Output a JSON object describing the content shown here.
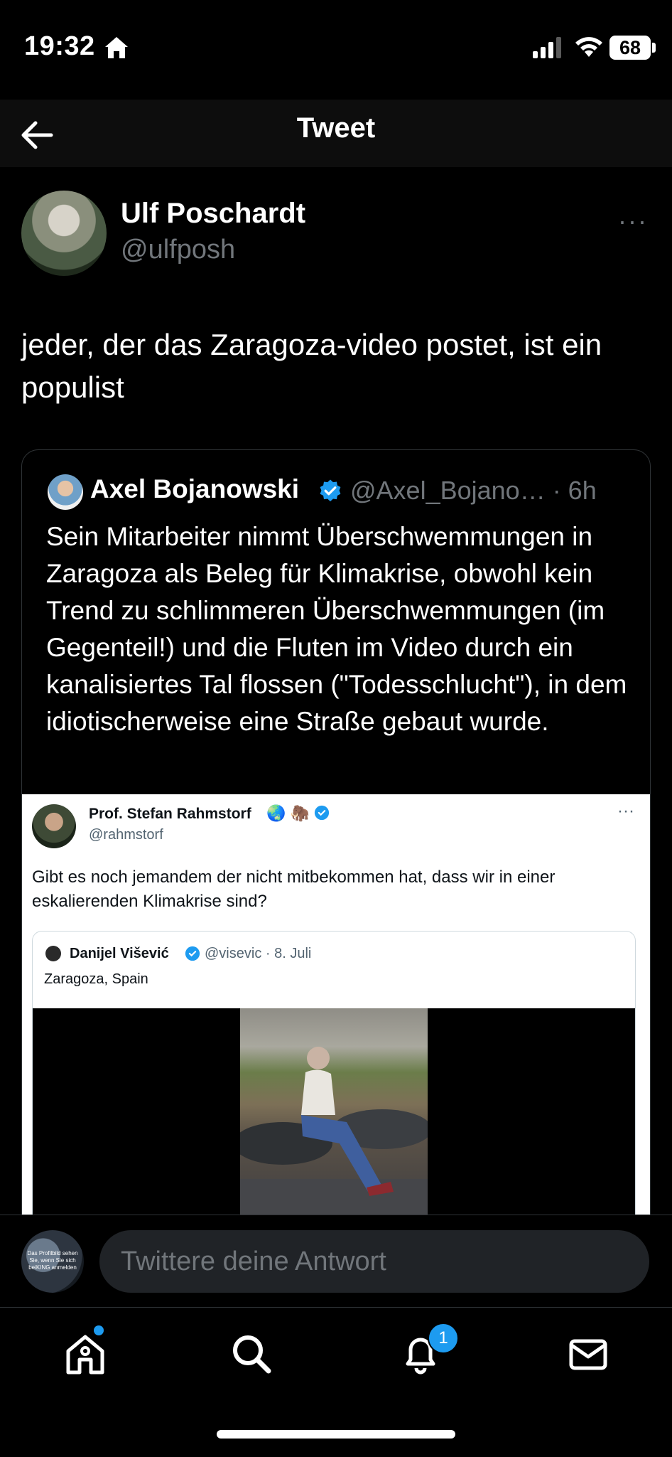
{
  "status_bar": {
    "time": "19:32",
    "battery": "68"
  },
  "header": {
    "title": "Tweet"
  },
  "tweet": {
    "author_name": "Ulf Poschardt",
    "author_handle": "@ulfposh",
    "more": "···",
    "text": "jeder, der das Zaragoza-video postet, ist ein populist"
  },
  "quote": {
    "author_name": "Axel Bojanowski",
    "handle_time": "@Axel_Bojano… · 6h",
    "text": "Sein Mitarbeiter nimmt Überschwemmungen in Zaragoza als Beleg für Klimakrise, obwohl kein Trend zu schlimmeren Überschwemmungen (im Gegenteil!) und die Fluten im Video durch ein kanalisiertes Tal flossen (\"Todesschlucht\"), in dem idiotischerweise eine Straße gebaut wurde.",
    "screenshot": {
      "author_name": "Prof. Stefan Rahmstorf",
      "emojis": "🌏 🦣",
      "author_handle": "@rahmstorf",
      "more": "···",
      "text": "Gibt es noch jemandem der nicht mitbekommen hat, dass wir in einer eskalierenden Klimakrise sind?",
      "inner": {
        "author_name": "Danijel Višević",
        "handle_date": "@visevic · 8. Juli",
        "text": "Zaragoza, Spain"
      }
    }
  },
  "reply": {
    "avatar_caption": "Das Profilbild sehen Sie, wenn Sie sich beiKING anmelden",
    "placeholder": "Twittere deine Antwort"
  },
  "tabs": {
    "items": [
      "home-icon",
      "search-icon",
      "bell-icon",
      "mail-icon"
    ],
    "notification_count": "1"
  },
  "colors": {
    "accent": "#1d9bf0",
    "background": "#000000",
    "secondary_text": "#71767b"
  }
}
